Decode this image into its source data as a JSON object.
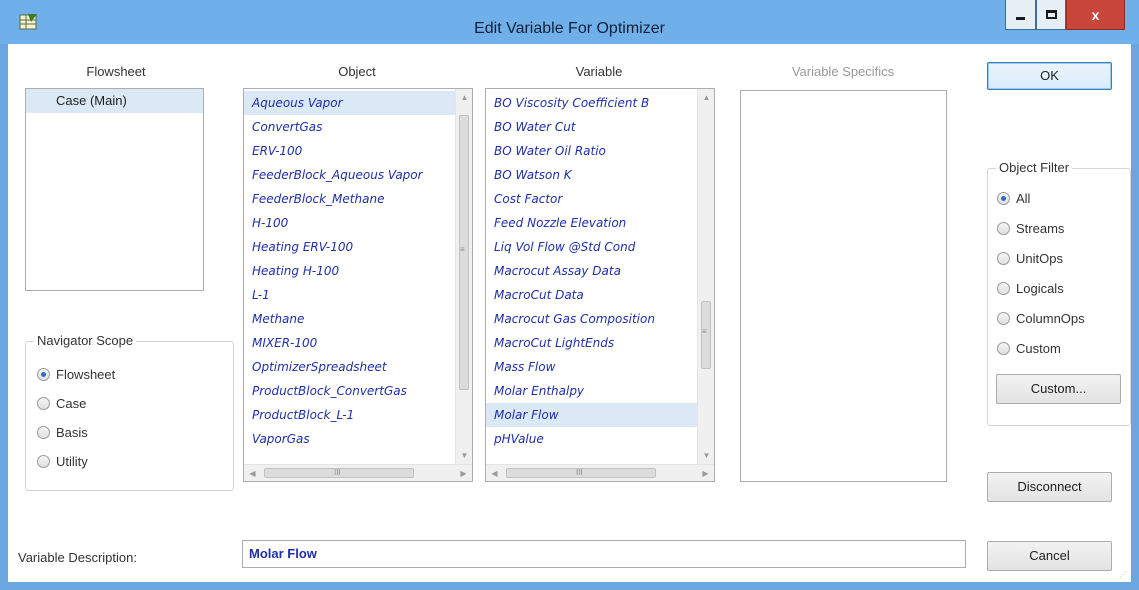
{
  "window": {
    "title": "Edit Variable For Optimizer",
    "icons": {
      "app": "spreadsheet-app-icon",
      "minimize": "minimize-icon",
      "maximize": "maximize-icon",
      "close": "close-icon"
    },
    "close_glyph": "x"
  },
  "columns": {
    "flowsheet": "Flowsheet",
    "object": "Object",
    "variable": "Variable",
    "specifics": "Variable Specifics"
  },
  "flowsheet_list": {
    "items": [
      "Case (Main)"
    ],
    "selected_index": 0
  },
  "object_list": {
    "items": [
      "Aqueous Vapor",
      "ConvertGas",
      "ERV-100",
      "FeederBlock_Aqueous Vapor",
      "FeederBlock_Methane",
      "H-100",
      "Heating ERV-100",
      "Heating H-100",
      "L-1",
      "Methane",
      "MIXER-100",
      "OptimizerSpreadsheet",
      "ProductBlock_ConvertGas",
      "ProductBlock_L-1",
      "VaporGas"
    ],
    "selected_index": 0
  },
  "variable_list": {
    "items": [
      "BO Viscosity Coefficient B",
      "BO Water Cut",
      "BO Water Oil Ratio",
      "BO Watson K",
      "Cost Factor",
      "Feed Nozzle Elevation",
      "Liq Vol Flow @Std Cond",
      "Macrocut Assay Data",
      "MacroCut Data",
      "Macrocut Gas Composition",
      "MacroCut LightEnds",
      "Mass Flow",
      "Molar Enthalpy",
      "Molar Flow",
      "pHValue"
    ],
    "selected_index": 13
  },
  "scroll_glyphs": {
    "up": "▲",
    "down": "▼",
    "left": "◀",
    "right": "▶",
    "grip_v": "≡",
    "grip_h": "III"
  },
  "navigator_scope": {
    "legend": "Navigator Scope",
    "options": [
      "Flowsheet",
      "Case",
      "Basis",
      "Utility"
    ],
    "selected_index": 0
  },
  "object_filter": {
    "legend": "Object Filter",
    "options": [
      "All",
      "Streams",
      "UnitOps",
      "Logicals",
      "ColumnOps",
      "Custom"
    ],
    "selected_index": 0,
    "custom_button": "Custom..."
  },
  "buttons": {
    "ok": "OK",
    "disconnect": "Disconnect",
    "cancel": "Cancel"
  },
  "description": {
    "label": "Variable Description:",
    "value": "Molar Flow"
  }
}
